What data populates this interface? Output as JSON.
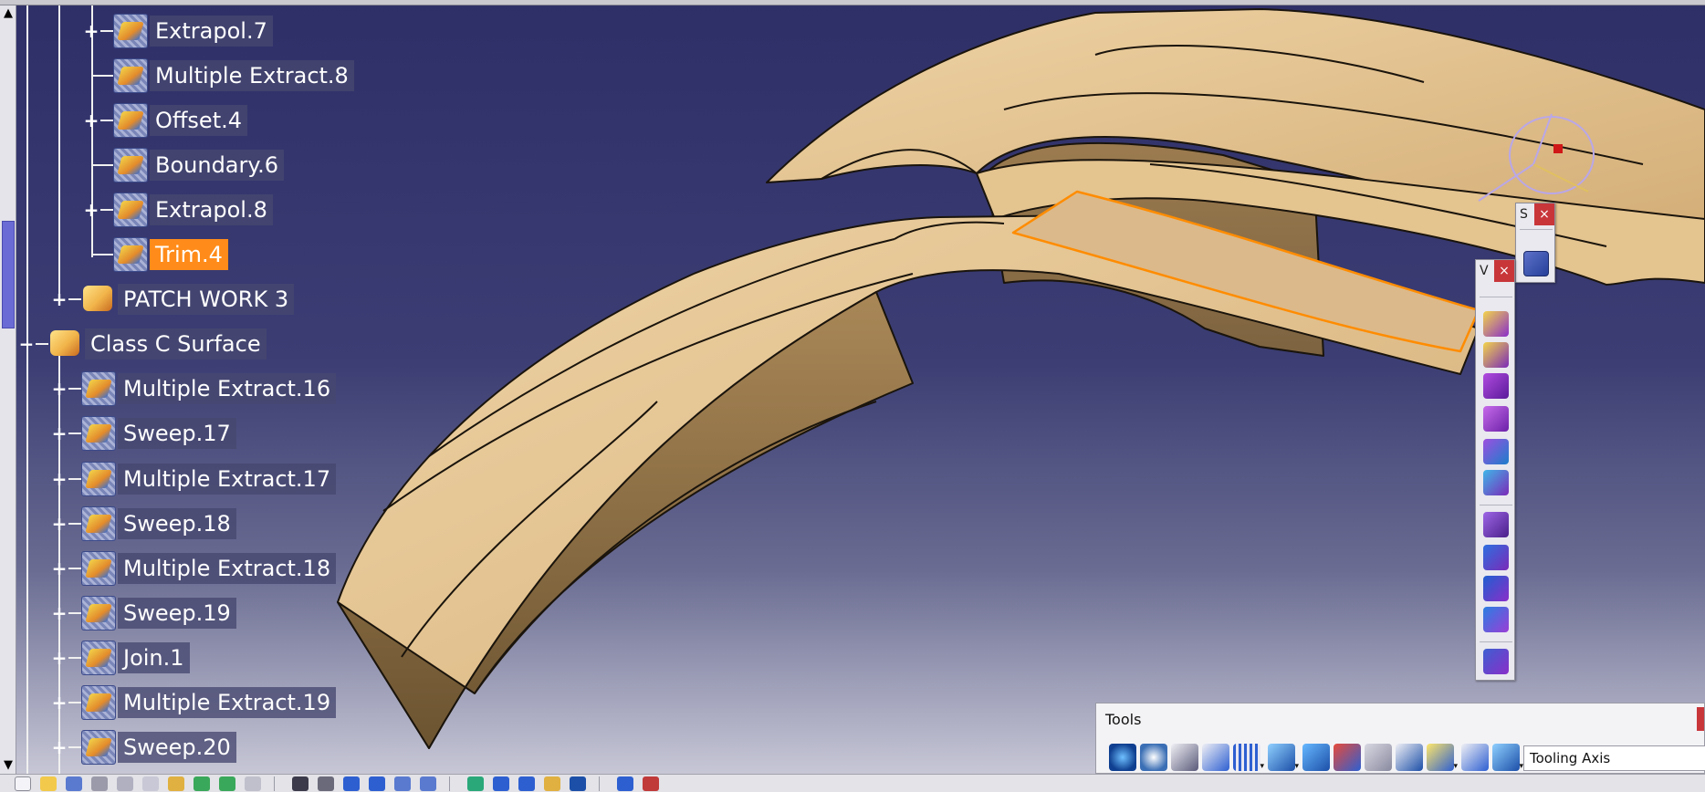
{
  "tree": {
    "items": [
      {
        "label": "Extrapol.7",
        "expander": "+",
        "icon": "extrapolate-icon"
      },
      {
        "label": "Multiple Extract.8",
        "expander": "",
        "icon": "multiple-extract-icon"
      },
      {
        "label": "Offset.4",
        "expander": "+",
        "icon": "offset-icon"
      },
      {
        "label": "Boundary.6",
        "expander": "",
        "icon": "boundary-icon"
      },
      {
        "label": "Extrapol.8",
        "expander": "+",
        "icon": "extrapolate-icon"
      },
      {
        "label": "Trim.4",
        "expander": "",
        "icon": "trim-icon",
        "selected": true
      },
      {
        "label": "PATCH WORK 3",
        "expander": "+",
        "icon": "geometrical-set-icon"
      },
      {
        "label": "Class C Surface",
        "expander": "−",
        "icon": "geometrical-set-icon"
      },
      {
        "label": "Multiple Extract.16",
        "expander": "+",
        "icon": "multiple-extract-icon"
      },
      {
        "label": "Sweep.17",
        "expander": "+",
        "icon": "sweep-icon"
      },
      {
        "label": "Multiple Extract.17",
        "expander": "+",
        "icon": "multiple-extract-icon"
      },
      {
        "label": "Sweep.18",
        "expander": "+",
        "icon": "sweep-icon"
      },
      {
        "label": "Multiple Extract.18",
        "expander": "+",
        "icon": "multiple-extract-icon"
      },
      {
        "label": "Sweep.19",
        "expander": "+",
        "icon": "sweep-icon"
      },
      {
        "label": "Join.1",
        "expander": "+",
        "icon": "join-icon"
      },
      {
        "label": "Multiple Extract.19",
        "expander": "+",
        "icon": "multiple-extract-icon"
      },
      {
        "label": "Sweep.20",
        "expander": "+",
        "icon": "sweep-icon"
      }
    ]
  },
  "scrollbar": {
    "up_arrow": "▲",
    "down_arrow": "▼"
  },
  "palettes": {
    "sketcher": {
      "title": "S",
      "close": "×"
    },
    "view": {
      "title": "V",
      "close": "×"
    }
  },
  "tools_toolbar": {
    "title": "Tools",
    "combo_value": "Tooling Axis"
  },
  "colors": {
    "background_top": "#2f2f68",
    "background_bottom": "#cfcfdc",
    "tree_text": "#ffffff",
    "selection": "#ff8c1a",
    "surface": "#d8b47e",
    "highlight_edge": "#ff8c00",
    "close_button": "#c8363a"
  }
}
